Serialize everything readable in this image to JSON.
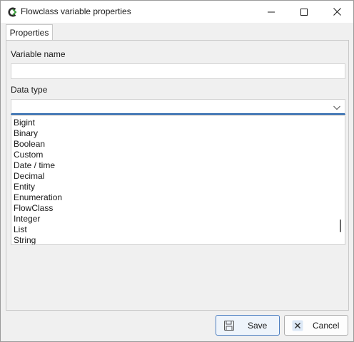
{
  "window": {
    "title": "Flowclass variable properties",
    "app_icon": "flowclass-logo-icon",
    "controls": [
      "minimize-icon",
      "maximize-icon",
      "close-icon"
    ]
  },
  "tabs": [
    {
      "label": "Properties",
      "selected": true
    }
  ],
  "form": {
    "variable_name": {
      "label": "Variable name",
      "value": ""
    },
    "data_type": {
      "label": "Data type",
      "selected": "",
      "expanded": true,
      "options": [
        "Bigint",
        "Binary",
        "Boolean",
        "Custom",
        "Date / time",
        "Decimal",
        "Entity",
        "Enumeration",
        "FlowClass",
        "Integer",
        "List",
        "String"
      ]
    }
  },
  "buttons": {
    "save": {
      "label": "Save",
      "icon": "floppy-disk-icon"
    },
    "cancel": {
      "label": "Cancel",
      "icon": "close-x-icon"
    }
  },
  "colors": {
    "accent": "#1f5ea8",
    "logo_green": "#3a9b3a"
  }
}
